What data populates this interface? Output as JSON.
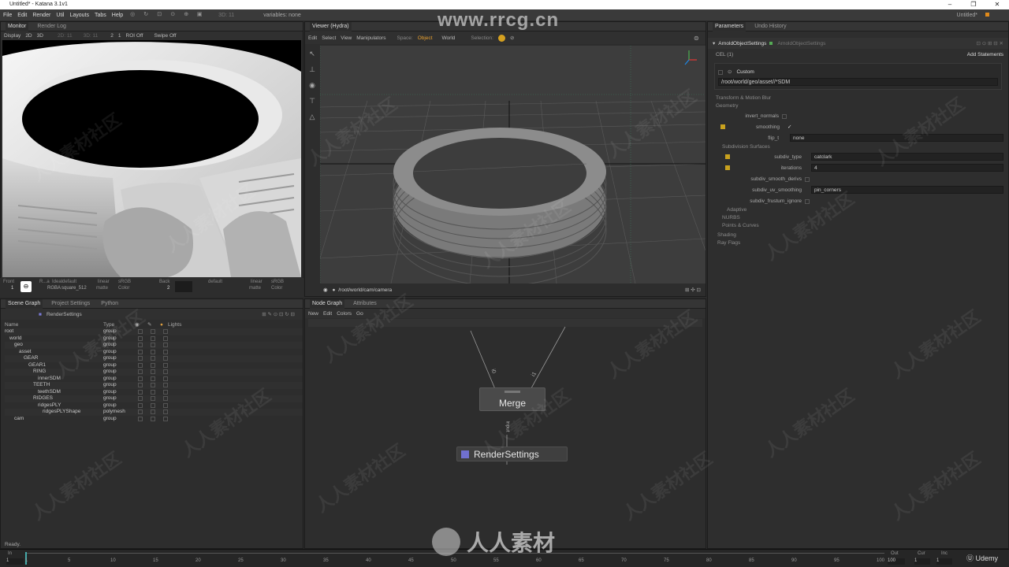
{
  "app": {
    "title": "Untitled* - Katana 3.1v1",
    "window_controls": [
      "–",
      "❐",
      "✕"
    ],
    "workspace": "Untitled*",
    "watermark_url": "www.rrcg.cn",
    "watermark_cn": "人人素材社区",
    "bottom_brand": "人人素材",
    "udemy": "Udemy"
  },
  "menu": [
    "File",
    "Edit",
    "Render",
    "Util",
    "Layouts",
    "Tabs",
    "Help"
  ],
  "menu_variables": "variables: none",
  "menu_3d": "3D: 11",
  "monitor": {
    "tabs": [
      "Monitor",
      "Render Log"
    ],
    "toolbar": [
      "Display",
      "2D",
      "3D",
      "2D: 11",
      "3D: 11",
      "2",
      "1",
      "ROI Off",
      "Swipe Off"
    ],
    "bottom": {
      "front": "Front",
      "back": "Back",
      "frame": "1",
      "frame2": "2",
      "r_label": "R...a",
      "ideal": "Idealdefault",
      "linear": "linear",
      "srgb": "sRGB",
      "rgba": "RGBA",
      "square": "square_512",
      "matte": "matte",
      "color": "Color",
      "default": "default",
      "linear2": "linear",
      "srgb2": "sRGB",
      "matte2": "matte",
      "color2": "Color"
    }
  },
  "viewer": {
    "tabs": [
      "Viewer (Hydra)"
    ],
    "menu": [
      "Edit",
      "Select",
      "View",
      "Manipulators"
    ],
    "space_label": "Space:",
    "space_object": "Object",
    "space_world": "World",
    "selection_label": "Selection:",
    "camera_path": "/root/world/cam/camera"
  },
  "params": {
    "tabs": [
      "Parameters",
      "Undo History"
    ],
    "node_name": "ArnoldObjectSettings",
    "node_type": "ArnoldObjectSettings",
    "cel": "CEL (1)",
    "add_statements": "Add Statements",
    "custom_label": "Custom",
    "cel_path": "/root/world/geo/asset//*SDM",
    "sections": {
      "transform": "Transform & Motion Blur",
      "geometry": "Geometry",
      "subdivision": "Subdivision Surfaces",
      "adaptive": "Adaptive",
      "nurbs": "NURBS",
      "points": "Points & Curves",
      "shading": "Shading",
      "ray_flags": "Ray Flags"
    },
    "fields": {
      "invert_normals": "invert_normals",
      "smoothing": "smoothing",
      "smoothing_val": "✓",
      "flip_t": "flip_t",
      "flip_t_val": "none",
      "subdiv_type": "subdiv_type",
      "subdiv_type_val": "catclark",
      "iterations": "iterations",
      "iterations_val": "4",
      "smooth_derivs": "subdiv_smooth_derivs",
      "uv_smoothing": "subdiv_uv_smoothing",
      "uv_smoothing_val": "pin_corners",
      "frustum_ignore": "subdiv_frustum_ignore"
    }
  },
  "scene": {
    "tabs": [
      "Scene Graph",
      "Project Settings",
      "Python"
    ],
    "root_node": "RenderSettings",
    "columns": [
      "Name",
      "Type",
      "Lights"
    ],
    "rows": [
      {
        "name": "root",
        "type": "group",
        "indent": 0
      },
      {
        "name": "world",
        "type": "group",
        "indent": 1
      },
      {
        "name": "geo",
        "type": "group",
        "indent": 2
      },
      {
        "name": "asset",
        "type": "group",
        "indent": 3
      },
      {
        "name": "GEAR",
        "type": "group",
        "indent": 4
      },
      {
        "name": "GEAR1",
        "type": "group",
        "indent": 5
      },
      {
        "name": "RING",
        "type": "group",
        "indent": 6
      },
      {
        "name": "innerSDM",
        "type": "group",
        "indent": 7
      },
      {
        "name": "TEETH",
        "type": "group",
        "indent": 6
      },
      {
        "name": "teethSDM",
        "type": "group",
        "indent": 7
      },
      {
        "name": "RIDGES",
        "type": "group",
        "indent": 6
      },
      {
        "name": "ridgesPLY",
        "type": "group",
        "indent": 7
      },
      {
        "name": "ridgesPLYShape",
        "type": "polymesh",
        "indent": 8
      },
      {
        "name": "cam",
        "type": "group",
        "indent": 2
      }
    ]
  },
  "nodegraph": {
    "tabs": [
      "Node Graph",
      "Attributes"
    ],
    "menu": [
      "New",
      "Edit",
      "Colors",
      "Go"
    ],
    "merge": "Merge",
    "render": "RenderSettings",
    "input_label": "input",
    "i0": "i0",
    "i1": "i1"
  },
  "status": "Ready.",
  "timeline": {
    "in_label": "In",
    "in_val": "1",
    "out_label": "Out",
    "out_val": "100",
    "cur_label": "Cur",
    "cur_val": "1",
    "inc_label": "Inc",
    "inc_val": "1",
    "ticks": [
      "1",
      "5",
      "10",
      "15",
      "20",
      "25",
      "30",
      "35",
      "40",
      "45",
      "50",
      "55",
      "60",
      "65",
      "70",
      "75",
      "80",
      "85",
      "90",
      "95",
      "100"
    ]
  }
}
